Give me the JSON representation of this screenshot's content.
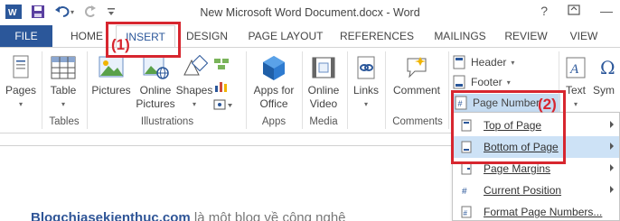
{
  "window": {
    "title": "New Microsoft Word Document.docx - Word",
    "help": "?",
    "min": "—"
  },
  "tabs": [
    {
      "label": "FILE"
    },
    {
      "label": "HOME"
    },
    {
      "label": "INSERT"
    },
    {
      "label": "DESIGN"
    },
    {
      "label": "PAGE LAYOUT"
    },
    {
      "label": "REFERENCES"
    },
    {
      "label": "MAILINGS"
    },
    {
      "label": "REVIEW"
    },
    {
      "label": "VIEW"
    }
  ],
  "ribbon": {
    "pages": "Pages",
    "table": "Table",
    "pictures": "Pictures",
    "online_pictures_1": "Online",
    "online_pictures_2": "Pictures",
    "shapes": "Shapes",
    "apps_for_office_1": "Apps for",
    "apps_for_office_2": "Office",
    "online_video_1": "Online",
    "online_video_2": "Video",
    "links": "Links",
    "comment": "Comment",
    "header": "Header",
    "footer": "Footer",
    "page_number": "Page Number",
    "text": "Text",
    "symbols": "Sym",
    "groups": {
      "tables": "Tables",
      "illustrations": "Illustrations",
      "apps": "Apps",
      "media": "Media",
      "comments": "Comments"
    }
  },
  "menu": {
    "items": [
      {
        "label": "Top of Page"
      },
      {
        "label": "Bottom of Page"
      },
      {
        "label": "Page Margins"
      },
      {
        "label": "Current Position"
      },
      {
        "label": "Format Page Numbers..."
      }
    ]
  },
  "annotations": {
    "step1": "(1)",
    "step2": "(2)"
  },
  "document": {
    "text_bold": "Blogchiasekienthuc.com",
    "text_rest": " là một blog về công nghệ"
  },
  "colors": {
    "accent": "#2b579a",
    "annotation": "#d7262f",
    "highlight": "#cde2f6"
  }
}
